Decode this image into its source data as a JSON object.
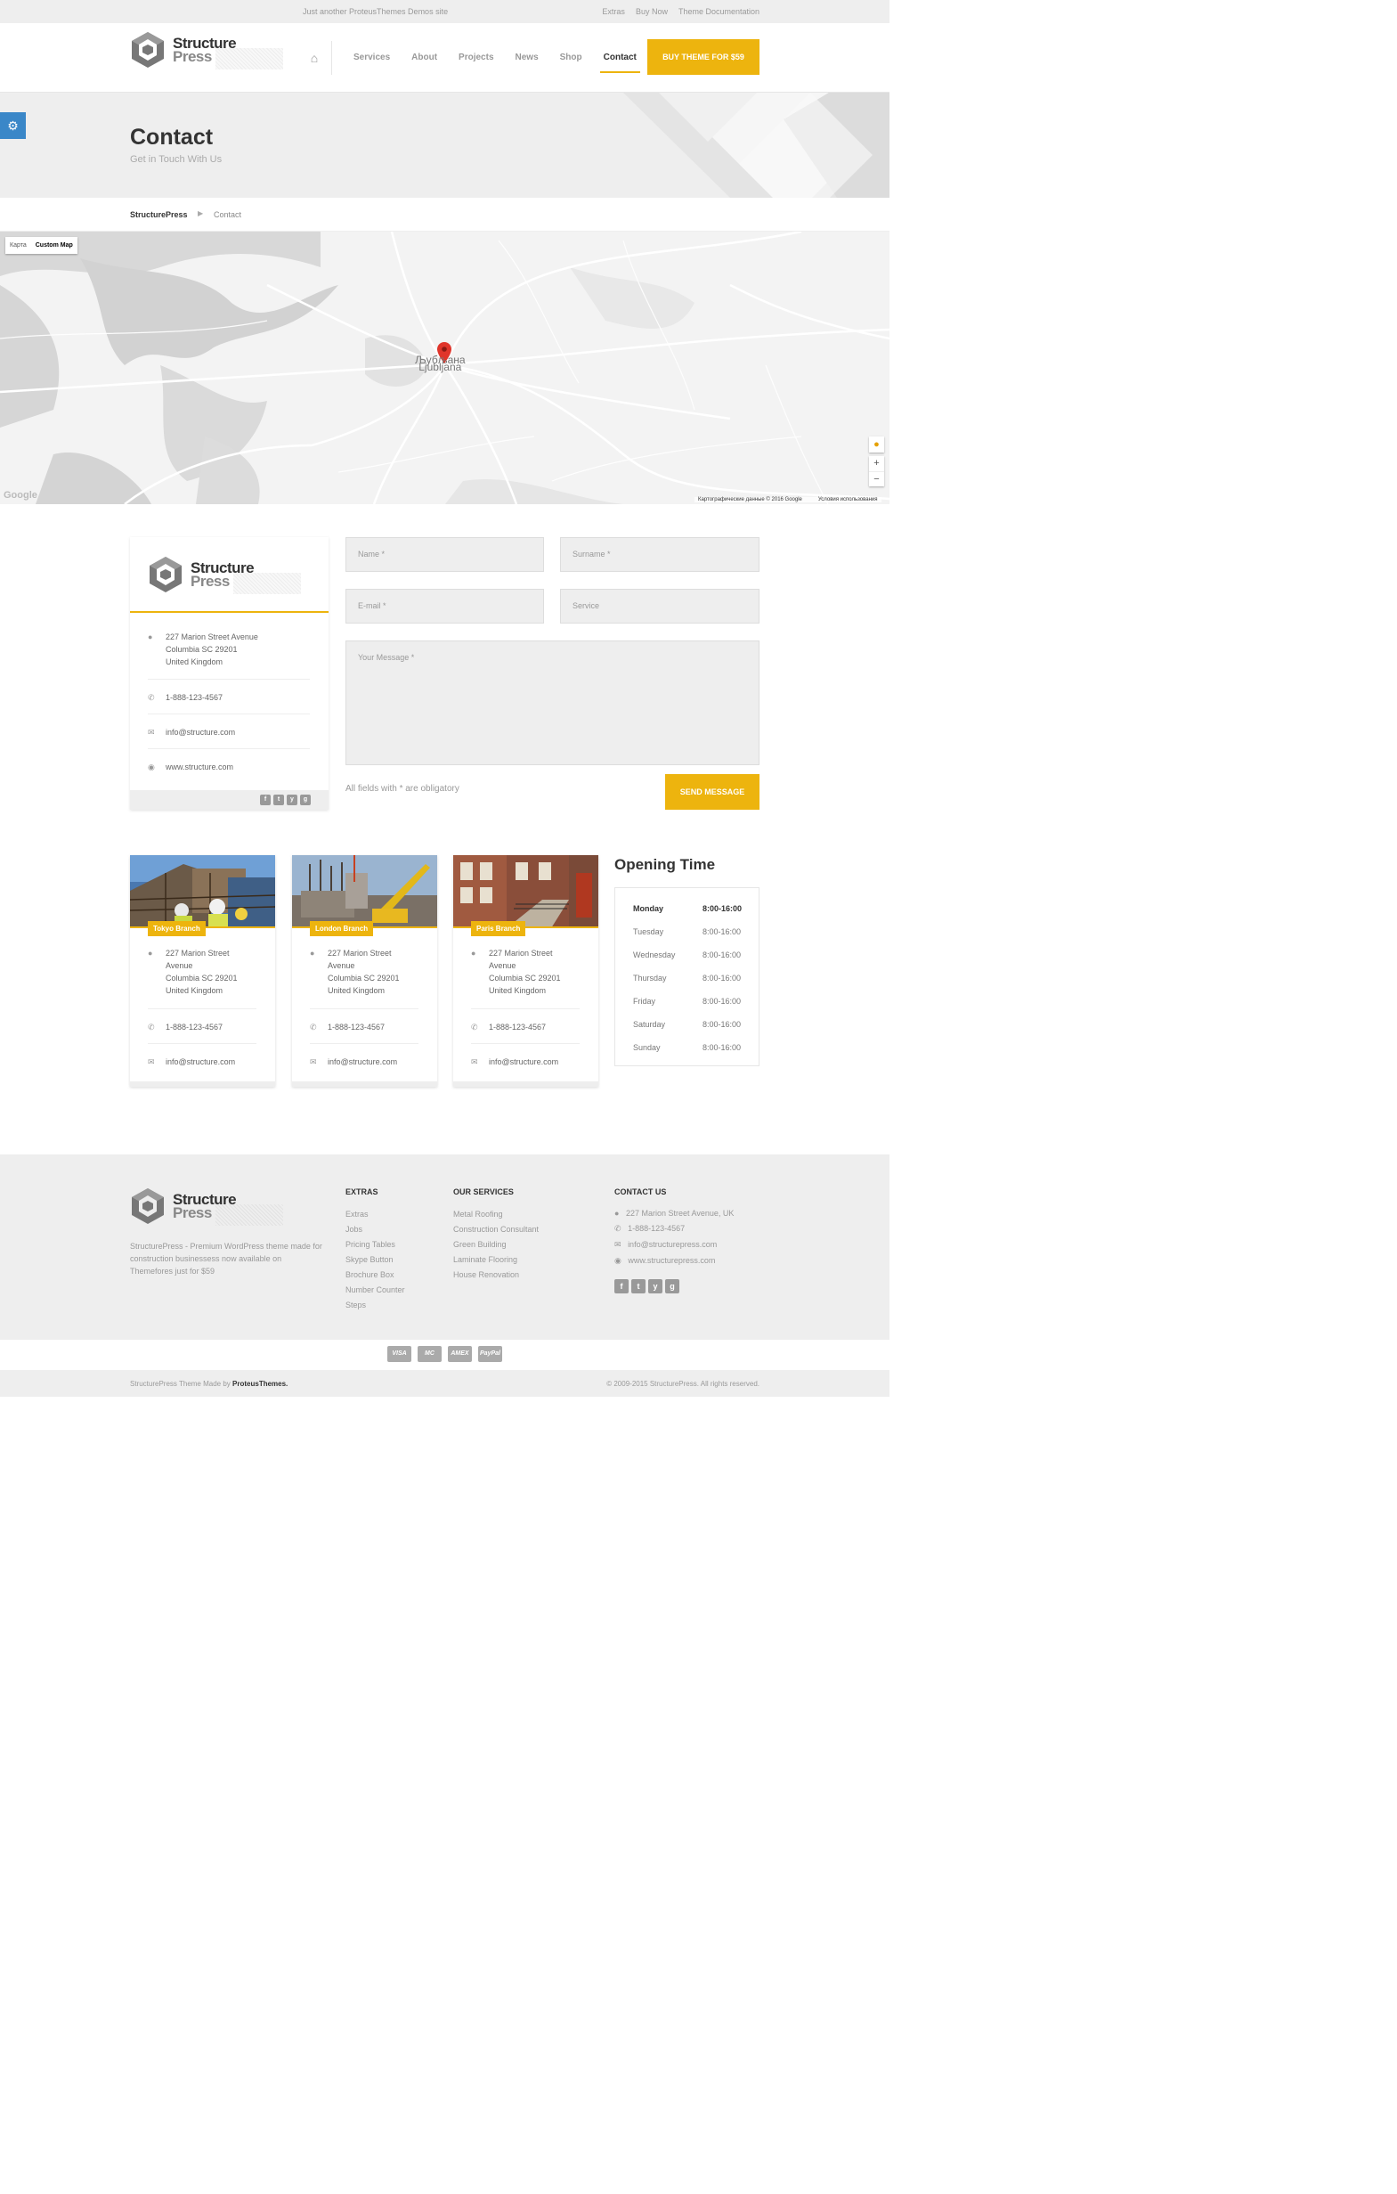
{
  "topbar": {
    "tagline": "Just another ProteusThemes Demos site",
    "links": [
      "Extras",
      "Buy Now",
      "Theme Documentation"
    ]
  },
  "logo": {
    "line1": "Structure",
    "line2": "Press"
  },
  "nav": {
    "items": [
      "Services",
      "About",
      "Projects",
      "News",
      "Shop",
      "Contact"
    ],
    "active": "Contact",
    "buy_label": "BUY THEME FOR $59"
  },
  "title": {
    "heading": "Contact",
    "subtitle": "Get in Touch With Us"
  },
  "breadcrumb": {
    "home": "StructurePress",
    "current": "Contact"
  },
  "map": {
    "type_buttons": [
      "Карта",
      "Custom Map"
    ],
    "city_cyrillic": "Љубљана",
    "city_latin": "Ljubljana",
    "credit": "Картографические данные © 2016 Google",
    "terms": "Условия использования",
    "brand": "Google"
  },
  "contact": {
    "address": [
      "227 Marion Street Avenue",
      "Columbia SC 29201",
      "United Kingdom"
    ],
    "phone": "1-888-123-4567",
    "email": "info@structure.com",
    "web": "www.structure.com"
  },
  "form": {
    "name": "Name *",
    "surname": "Surname *",
    "email": "E-mail *",
    "service": "Service",
    "message": "Your Message *",
    "hint": "All fields with * are obligatory",
    "send": "SEND MESSAGE"
  },
  "branches": [
    {
      "name": "Tokyo Branch",
      "address": [
        "227 Marion Street",
        "Avenue",
        "Columbia SC 29201",
        "United Kingdom"
      ],
      "phone": "1-888-123-4567",
      "email": "info@structure.com"
    },
    {
      "name": "London Branch",
      "address": [
        "227 Marion Street",
        "Avenue",
        "Columbia SC 29201",
        "United Kingdom"
      ],
      "phone": "1-888-123-4567",
      "email": "info@structure.com"
    },
    {
      "name": "Paris Branch",
      "address": [
        "227 Marion Street",
        "Avenue",
        "Columbia SC 29201",
        "United Kingdom"
      ],
      "phone": "1-888-123-4567",
      "email": "info@structure.com"
    }
  ],
  "hours": {
    "title": "Opening Time",
    "rows": [
      {
        "day": "Monday",
        "time": "8:00-16:00"
      },
      {
        "day": "Tuesday",
        "time": "8:00-16:00"
      },
      {
        "day": "Wednesday",
        "time": "8:00-16:00"
      },
      {
        "day": "Thursday",
        "time": "8:00-16:00"
      },
      {
        "day": "Friday",
        "time": "8:00-16:00"
      },
      {
        "day": "Saturday",
        "time": "8:00-16:00"
      },
      {
        "day": "Sunday",
        "time": "8:00-16:00"
      }
    ]
  },
  "footer": {
    "desc": "StructurePress - Premium WordPress theme made for construction businessess now available on Themefores just for $59",
    "extras_title": "EXTRAS",
    "extras": [
      "Extras",
      "Jobs",
      "Pricing Tables",
      "Skype Button",
      "Brochure Box",
      "Number Counter",
      "Steps"
    ],
    "services_title": "OUR SERVICES",
    "services": [
      "Metal Roofing",
      "Construction Consultant",
      "Green Building",
      "Laminate Flooring",
      "House Renovation"
    ],
    "contact_title": "CONTACT US",
    "contact": [
      "227 Marion Street Avenue, UK",
      "1-888-123-4567",
      "info@structurepress.com",
      "www.structurepress.com"
    ],
    "payments": [
      "VISA",
      "MC",
      "AMEX",
      "PayPal"
    ],
    "made_by": "StructurePress Theme Made by",
    "made_by_brand": "ProteusThemes.",
    "copyright": "© 2009-2015 StructurePress. All rights reserved."
  },
  "social": [
    "f",
    "t",
    "y",
    "g"
  ]
}
